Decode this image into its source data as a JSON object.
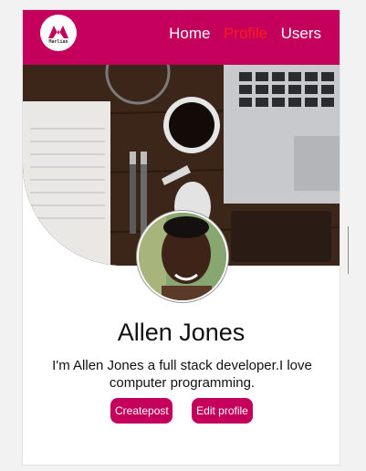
{
  "navbar": {
    "logo_text": "Marlian",
    "links": [
      {
        "label": "Home",
        "active": false
      },
      {
        "label": "Profile",
        "active": true
      },
      {
        "label": "Users",
        "active": false
      }
    ]
  },
  "profile": {
    "name": "Allen Jones",
    "bio": "I'm Allen Jones a full stack developer.I love computer programming."
  },
  "actions": {
    "create_post": "Createpost",
    "edit_profile": "Edit profile"
  },
  "colors": {
    "brand": "#c4005c",
    "active_link": "#ff1a1a"
  }
}
